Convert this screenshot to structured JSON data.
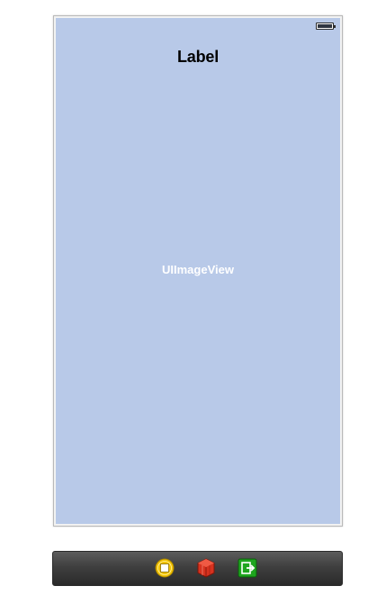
{
  "label": {
    "text": "Label"
  },
  "image_view": {
    "caption": "UIImageView"
  },
  "dock": {
    "icons": [
      "view-controller-icon",
      "first-responder-icon",
      "exit-icon"
    ]
  },
  "colors": {
    "screen_background": "#b8c9e8",
    "view_controller_icon": "#f2c200",
    "first_responder_icon": "#d6321f",
    "exit_icon": "#1ea51e"
  }
}
